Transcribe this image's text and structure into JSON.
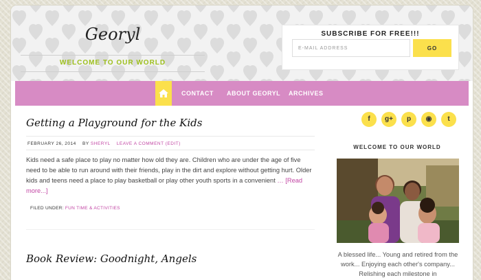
{
  "site": {
    "title": "Georyl",
    "description": "WELCOME TO OUR WORLD"
  },
  "subscribe": {
    "title": "SUBSCRIBE FOR FREE!!!",
    "placeholder": "E-MAIL ADDRESS",
    "button": "GO"
  },
  "nav": {
    "home_icon": "home-icon",
    "items": [
      "CONTACT",
      "ABOUT GEORYL",
      "ARCHIVES"
    ]
  },
  "posts": [
    {
      "title": "Getting a Playground for the Kids",
      "date": "FEBRUARY 26, 2014",
      "by": "BY",
      "author": "SHERYL",
      "comment": "LEAVE A COMMENT (EDIT)",
      "excerpt": "Kids need a safe place to play no matter how old they are. Children who are under the age of five need to be able to run around with their friends, play in the dirt and explore without getting hurt. Older kids and teens need a place to play basketball or play other youth sports in a convenient",
      "ellipsis": "…",
      "read_more": "[Read more...]",
      "filed_label": "FILED UNDER:",
      "category": "FUN TIME & ACTIVITIES"
    },
    {
      "title": "Book Review: Goodnight, Angels"
    }
  ],
  "social": {
    "icons": [
      "facebook-icon",
      "google-plus-icon",
      "pinterest-icon",
      "rss-icon",
      "twitter-icon"
    ],
    "glyphs": [
      "f",
      "g+",
      "p",
      "◉",
      "t"
    ]
  },
  "sidebar": {
    "widget_title": "WELCOME TO OUR WORLD",
    "text": "A blessed life... Young and retired from the work... Enjoying each other's company... Relishing each milestone in"
  },
  "colors": {
    "accent_yellow": "#fbe04c",
    "nav_pink": "#d78bc4",
    "link_pink": "#c246a4",
    "tagline_green": "#9dbf1c"
  }
}
